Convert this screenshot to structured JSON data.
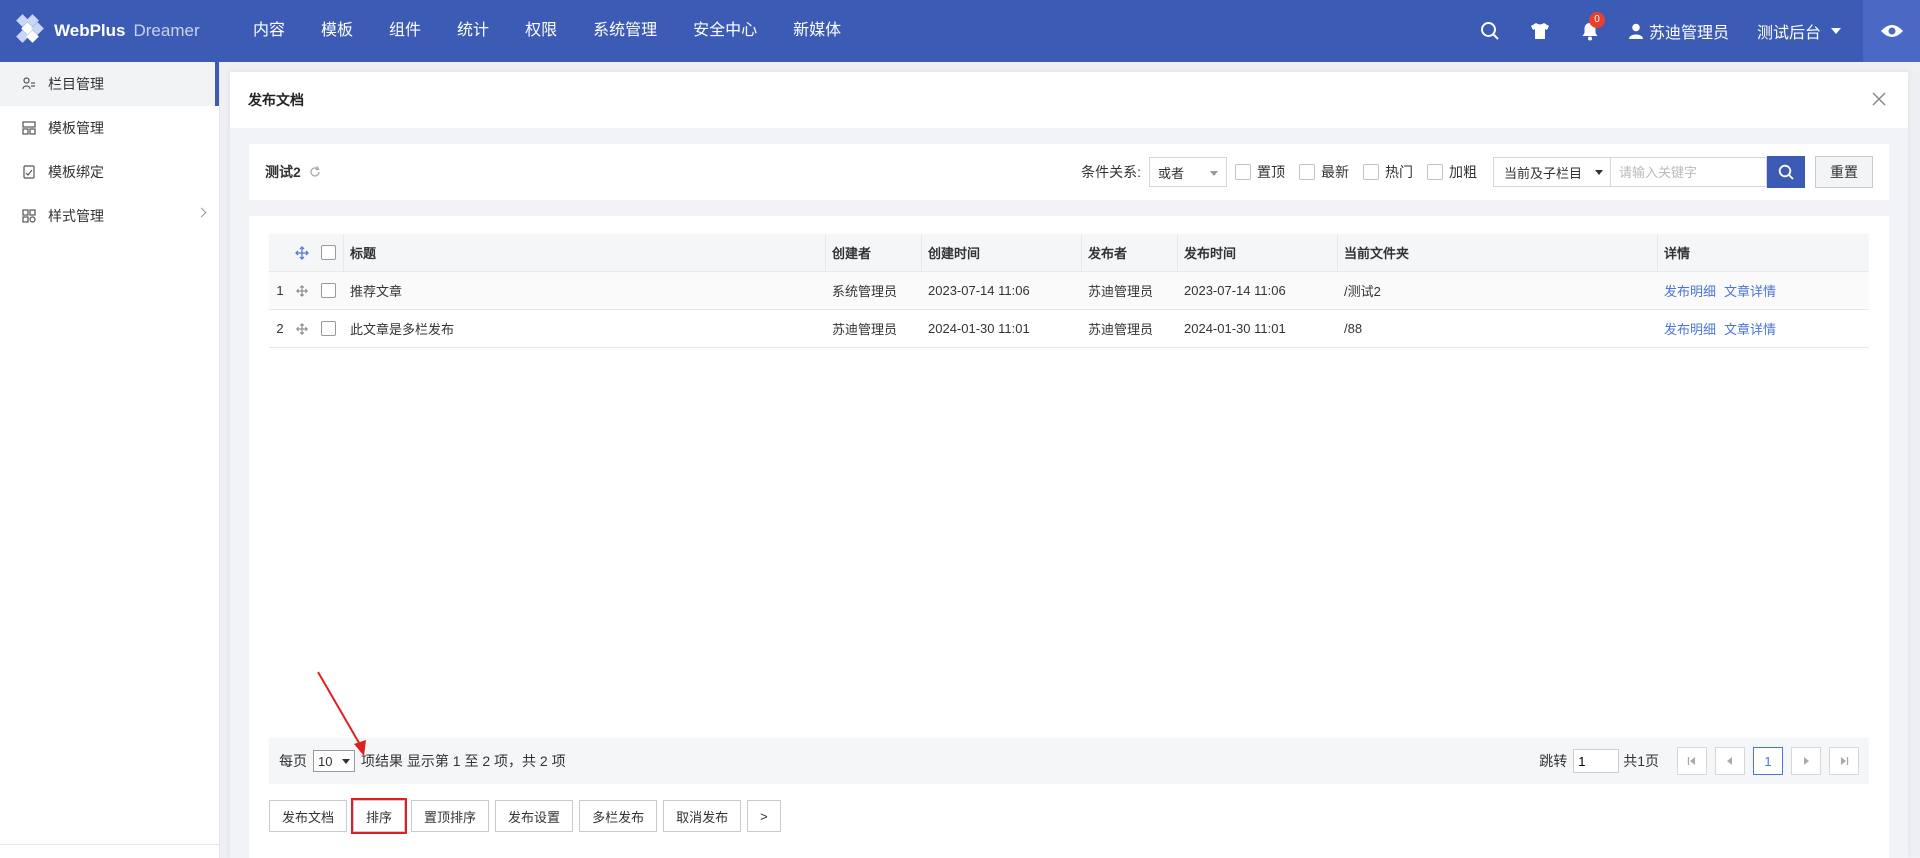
{
  "app": {
    "brand": "WebPlus",
    "brand_sub": "Dreamer"
  },
  "nav": [
    "内容",
    "模板",
    "组件",
    "统计",
    "权限",
    "系统管理",
    "安全中心",
    "新媒体"
  ],
  "header": {
    "notifications": "0",
    "user": "苏迪管理员",
    "site": "测试后台"
  },
  "sidebar": {
    "items": [
      {
        "label": "栏目管理",
        "icon": "column-icon",
        "active": true
      },
      {
        "label": "模板管理",
        "icon": "template-icon"
      },
      {
        "label": "模板绑定",
        "icon": "bind-icon"
      },
      {
        "label": "样式管理",
        "icon": "style-icon",
        "has_children": true
      }
    ]
  },
  "modal": {
    "title": "发布文档"
  },
  "filter": {
    "crumb": "测试2",
    "condition_label": "条件关系:",
    "condition_value": "或者",
    "checks": [
      "置顶",
      "最新",
      "热门",
      "加粗"
    ],
    "scope": "当前及子栏目",
    "keyword_placeholder": "请输入关键字",
    "reset": "重置"
  },
  "table": {
    "headers": {
      "title": "标题",
      "creator": "创建者",
      "created": "创建时间",
      "publisher": "发布者",
      "published": "发布时间",
      "folder": "当前文件夹",
      "detail": "详情"
    },
    "rows": [
      {
        "no": "1",
        "title": "推荐文章",
        "creator": "系统管理员",
        "created": "2023-07-14 11:06",
        "publisher": "苏迪管理员",
        "published": "2023-07-14 11:06",
        "folder": "/测试2",
        "link1": "发布明细",
        "link2": "文章详情"
      },
      {
        "no": "2",
        "title": "此文章是多栏发布",
        "creator": "苏迪管理员",
        "created": "2024-01-30 11:01",
        "publisher": "苏迪管理员",
        "published": "2024-01-30 11:01",
        "folder": "/88",
        "link1": "发布明细",
        "link2": "文章详情"
      }
    ]
  },
  "pager": {
    "per_page_label": "每页",
    "per_page_value": "10",
    "summary": "项结果 显示第 1 至 2 项，共 2 项",
    "jump_label": "跳转",
    "jump_value": "1",
    "total_pages": "共1页",
    "current": "1"
  },
  "actions": [
    "发布文档",
    "排序",
    "置顶排序",
    "发布设置",
    "多栏发布",
    "取消发布",
    ">"
  ],
  "colors": {
    "primary": "#3b5bb4",
    "link": "#4a74d6",
    "highlight": "#e02020"
  }
}
